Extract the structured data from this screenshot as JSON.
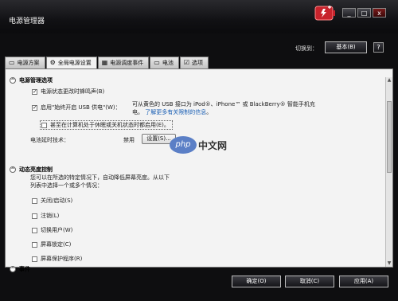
{
  "window": {
    "title": "电源管理器"
  },
  "header": {
    "switch_label": "切换到：",
    "basic_button": "基本(B)",
    "help_button": "?"
  },
  "window_controls": {
    "minimize": "_",
    "restore": "□",
    "close": "x"
  },
  "tabs": [
    {
      "label": "电源方案",
      "icon": "battery-plug-icon"
    },
    {
      "label": "全局电源设置",
      "icon": "gear-icon"
    },
    {
      "label": "电源调度事件",
      "icon": "calendar-icon"
    },
    {
      "label": "电池",
      "icon": "battery-icon"
    },
    {
      "label": "选项",
      "icon": "checkbox-icon"
    }
  ],
  "power_section": {
    "title": "电源管理选项",
    "items": [
      {
        "label": "电源状态更改时蜂鸣声(B)",
        "checked": true
      },
      {
        "label": "启用\"始终开启 USB 供电\"(W)：",
        "checked": true
      },
      {
        "label": "甚至在计算机处于休眠或关机状态时都启用(E)。",
        "checked": false
      }
    ],
    "usb_desc": "可从黄色的 USB 接口为 iPod®、iPhone™ 或 BlackBerry® 智能手机充",
    "usb_desc2": "电。",
    "usb_link": "了解更多有关限制的信息",
    "usb_link_end": "。",
    "battery_tech_label": "电池延时技术：",
    "battery_tech_value": "禁用",
    "settings_button": "设置(S)..."
  },
  "brightness_section": {
    "title": "动态亮度控制",
    "desc1": "您可以在所选的特定情况下，自动降低屏幕亮度。从以下",
    "desc2": "列表中选择一个或多个情况：",
    "items": [
      {
        "label": "关闭/启动(S)",
        "checked": false
      },
      {
        "label": "注销(L)",
        "checked": false
      },
      {
        "label": "切换用户(W)",
        "checked": false
      },
      {
        "label": "屏幕锁定(C)",
        "checked": false
      },
      {
        "label": "屏幕保护程序(R)",
        "checked": false
      }
    ]
  },
  "events_section": {
    "title": "事件"
  },
  "buttons": {
    "ok": "确定(O)",
    "cancel": "取消(C)",
    "apply": "应用(A)"
  },
  "watermark": {
    "logo": "php",
    "text": "中文网"
  },
  "colors": {
    "accent_red": "#c8232c",
    "link": "#1a5fb4",
    "chrome": "#0e0e10"
  }
}
